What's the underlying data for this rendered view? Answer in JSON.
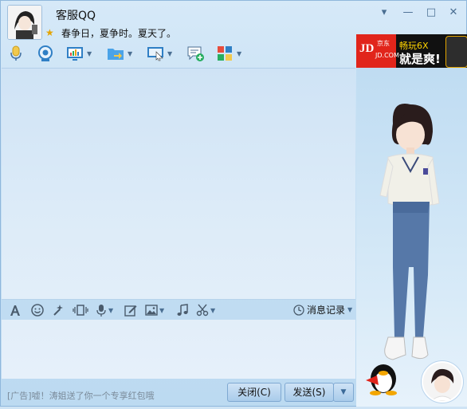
{
  "header": {
    "contact_name": "客服QQ",
    "signature": "春争日，夏争时。夏天了。"
  },
  "toolbar": {
    "icons": [
      "microphone-icon",
      "video-call-icon",
      "screen-share-icon",
      "file-transfer-icon",
      "remote-desktop-icon",
      "message-add-icon",
      "apps-icon"
    ]
  },
  "ad": {
    "brand_cn": "京东",
    "brand_logo": "JD",
    "brand_domain": "JD.COM",
    "line1": "畅玩6X",
    "line2": "就是爽!"
  },
  "input_toolbar": {
    "history_label": "消息记录"
  },
  "bottom": {
    "ad_tip": "[广告]嘘！涛姐送了你一个专享红包哦",
    "close_label": "关闭(C)",
    "send_label": "发送(S)"
  },
  "colors": {
    "window_bg": "#c6e0f4",
    "accent": "#7fa9d2",
    "ad_red": "#e1251b",
    "ad_yellow": "#ffd400"
  }
}
